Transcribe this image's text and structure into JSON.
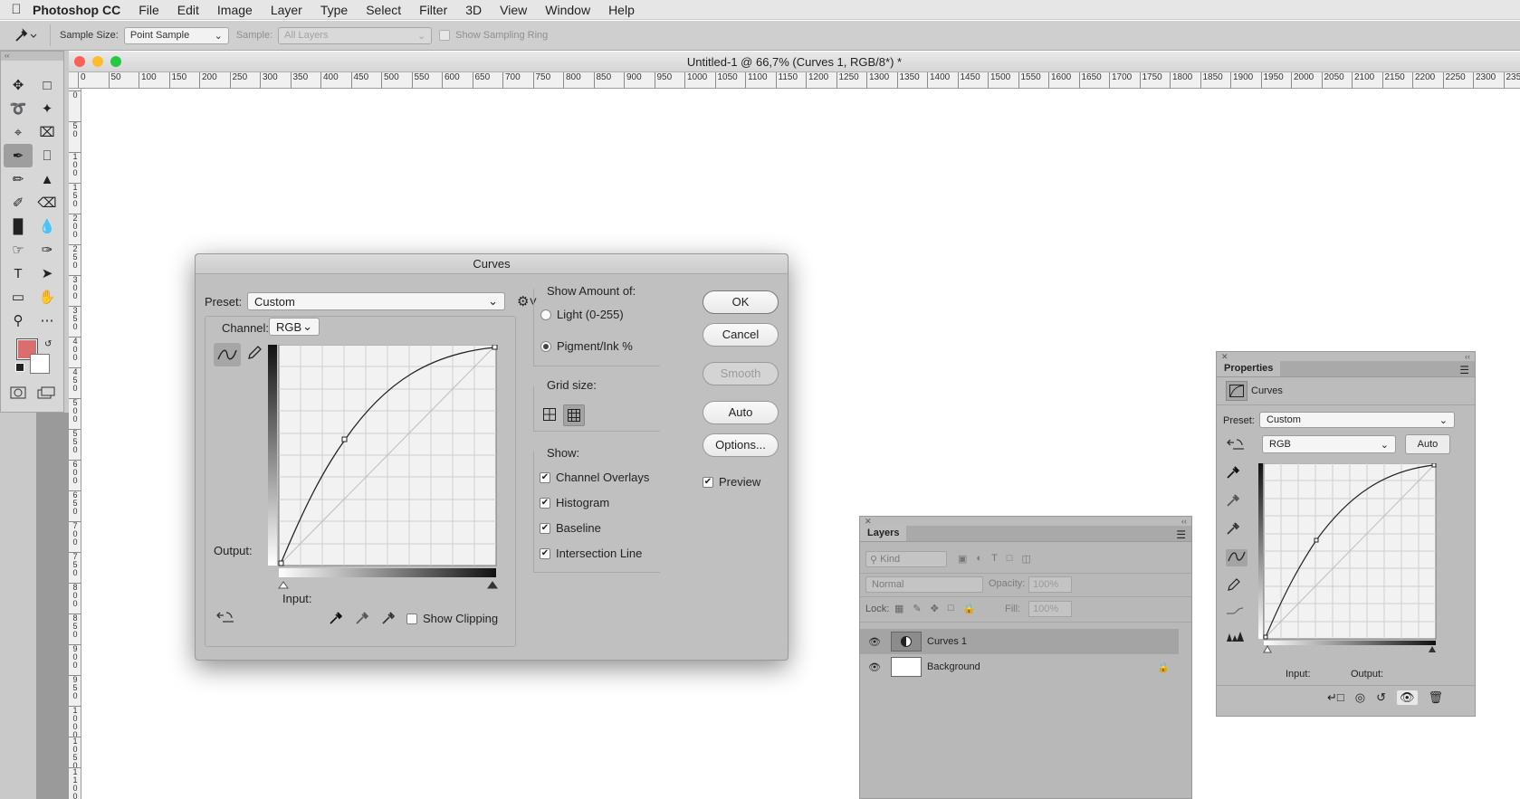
{
  "menubar": {
    "app_name": "Photoshop CC",
    "items": [
      "File",
      "Edit",
      "Image",
      "Layer",
      "Type",
      "Select",
      "Filter",
      "3D",
      "View",
      "Window",
      "Help"
    ]
  },
  "options_bar": {
    "sample_size_label": "Sample Size:",
    "sample_size_value": "Point Sample",
    "sample_label": "Sample:",
    "sample_value": "All Layers",
    "sampling_ring_label": "Show Sampling Ring"
  },
  "document": {
    "title": "Untitled-1 @ 66,7% (Curves 1, RGB/8*) *"
  },
  "rulers": {
    "h_labels": [
      "0",
      "50",
      "100",
      "150",
      "200",
      "250",
      "300",
      "350",
      "400",
      "450",
      "500",
      "550",
      "600",
      "650",
      "700",
      "750",
      "800",
      "850",
      "900",
      "950",
      "1000",
      "1050",
      "1100",
      "1150",
      "1200",
      "1250",
      "1300",
      "1350",
      "1400",
      "1450",
      "1500",
      "1550",
      "1600",
      "1650",
      "1700",
      "1750",
      "1800",
      "1850",
      "1900",
      "1950",
      "2000",
      "2050",
      "2100",
      "2150",
      "2200",
      "2250",
      "2300",
      "235"
    ],
    "v_labels": [
      "0",
      "50",
      "100",
      "150",
      "200",
      "250",
      "300",
      "350",
      "400",
      "450",
      "500",
      "550",
      "600",
      "650",
      "700",
      "750",
      "800",
      "850",
      "900",
      "950",
      "1000",
      "1050",
      "1100"
    ]
  },
  "tools": {
    "items": [
      "move-tool",
      "marquee-tool",
      "lasso-tool",
      "magic-wand-tool",
      "crop-tool",
      "frame-tool",
      "eyedropper-tool",
      "healing-tool",
      "brush-tool",
      "stamp-tool",
      "history-brush-tool",
      "eraser-tool",
      "gradient-tool",
      "blur-tool",
      "smudge-tool",
      "pen-tool",
      "type-tool",
      "path-select-tool",
      "rectangle-tool",
      "hand-tool",
      "zoom-tool",
      "more-tools"
    ],
    "foreground_color": "#d96e6e",
    "background_color": "#ffffff"
  },
  "curves_dialog": {
    "title": "Curves",
    "preset_label": "Preset:",
    "preset_value": "Custom",
    "channel_label": "Channel:",
    "channel_value": "RGB",
    "output_label": "Output:",
    "input_label": "Input:",
    "show_clipping_label": "Show Clipping",
    "show_amount_label": "Show Amount of:",
    "light_label": "Light  (0-255)",
    "pigment_label": "Pigment/Ink %",
    "grid_size_label": "Grid size:",
    "show_label": "Show:",
    "show_options": [
      {
        "label": "Channel Overlays",
        "checked": true
      },
      {
        "label": "Histogram",
        "checked": true
      },
      {
        "label": "Baseline",
        "checked": true
      },
      {
        "label": "Intersection Line",
        "checked": true
      }
    ],
    "buttons": {
      "ok": "OK",
      "cancel": "Cancel",
      "smooth": "Smooth",
      "auto": "Auto",
      "options": "Options..."
    },
    "preview_label": "Preview"
  },
  "layers_panel": {
    "tab": "Layers",
    "kind_label": "Kind",
    "blend_mode": "Normal",
    "opacity_label": "Opacity:",
    "opacity_value": "100%",
    "lock_label": "Lock:",
    "fill_label": "Fill:",
    "fill_value": "100%",
    "layers": [
      {
        "name": "Curves 1",
        "selected": true
      },
      {
        "name": "Background",
        "selected": false,
        "locked": true
      }
    ]
  },
  "properties_panel": {
    "tab": "Properties",
    "type_label": "Curves",
    "preset_label": "Preset:",
    "preset_value": "Custom",
    "channel_value": "RGB",
    "auto_label": "Auto",
    "input_label": "Input:",
    "output_label": "Output:"
  },
  "colors": {
    "panel_bg": "#c0c0c0",
    "canvas": "#ffffff",
    "close": "#fc5f57",
    "minimize": "#fdbc2e",
    "zoom": "#28c840"
  }
}
